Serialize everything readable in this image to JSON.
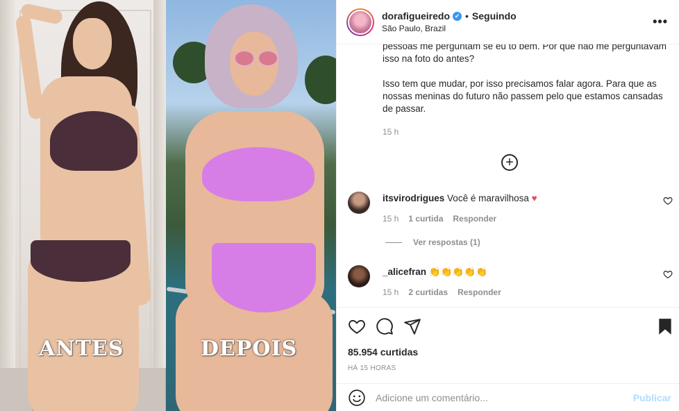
{
  "post": {
    "username": "dorafigueiredo",
    "verified_mark": "✔",
    "separator": "•",
    "follow_status": "Seguindo",
    "location": "São Paulo, Brazil",
    "more_icon": "more-options-icon",
    "more_glyph": "•••"
  },
  "image": {
    "left_label": "ANTES",
    "right_label": "DEPOIS"
  },
  "caption": {
    "paragraph1": "pessoas me perguntam se eu to bem. Por que não me perguntavam isso na foto do antes?",
    "paragraph2": "Isso tem que mudar, por isso precisamos falar agora. Para que as nossas meninas do futuro não passem pelo que estamos cansadas de passar.",
    "time": "15 h",
    "load_more_icon": "plus-circle-icon",
    "load_more_glyph": "+"
  },
  "comments": [
    {
      "user": "itsvirodrigues",
      "text": "Você é maravilhosa",
      "emoji": "♥",
      "time": "15 h",
      "likes": "1 curtida",
      "reply": "Responder"
    },
    {
      "user": "_alicefran",
      "text": "",
      "emoji": "👏👏👏👏👏",
      "time": "15 h",
      "likes": "2 curtidas",
      "reply": "Responder"
    }
  ],
  "view_replies": "Ver respostas (1)",
  "actions": {
    "like_icon": "heart-icon",
    "comment_icon": "comment-bubble-icon",
    "share_icon": "paper-plane-icon",
    "save_icon": "bookmark-icon",
    "likes": "85.954 curtidas",
    "posted_ago": "HÁ 15 HORAS"
  },
  "add_comment": {
    "emoji_icon": "smiley-icon",
    "placeholder": "Adicione um comentário...",
    "publish": "Publicar"
  },
  "colors": {
    "link_blue_disabled": "#b3dbff",
    "verified_blue": "#3897f0",
    "secondary_text": "#8e8e8e",
    "primary_text": "#262626"
  }
}
